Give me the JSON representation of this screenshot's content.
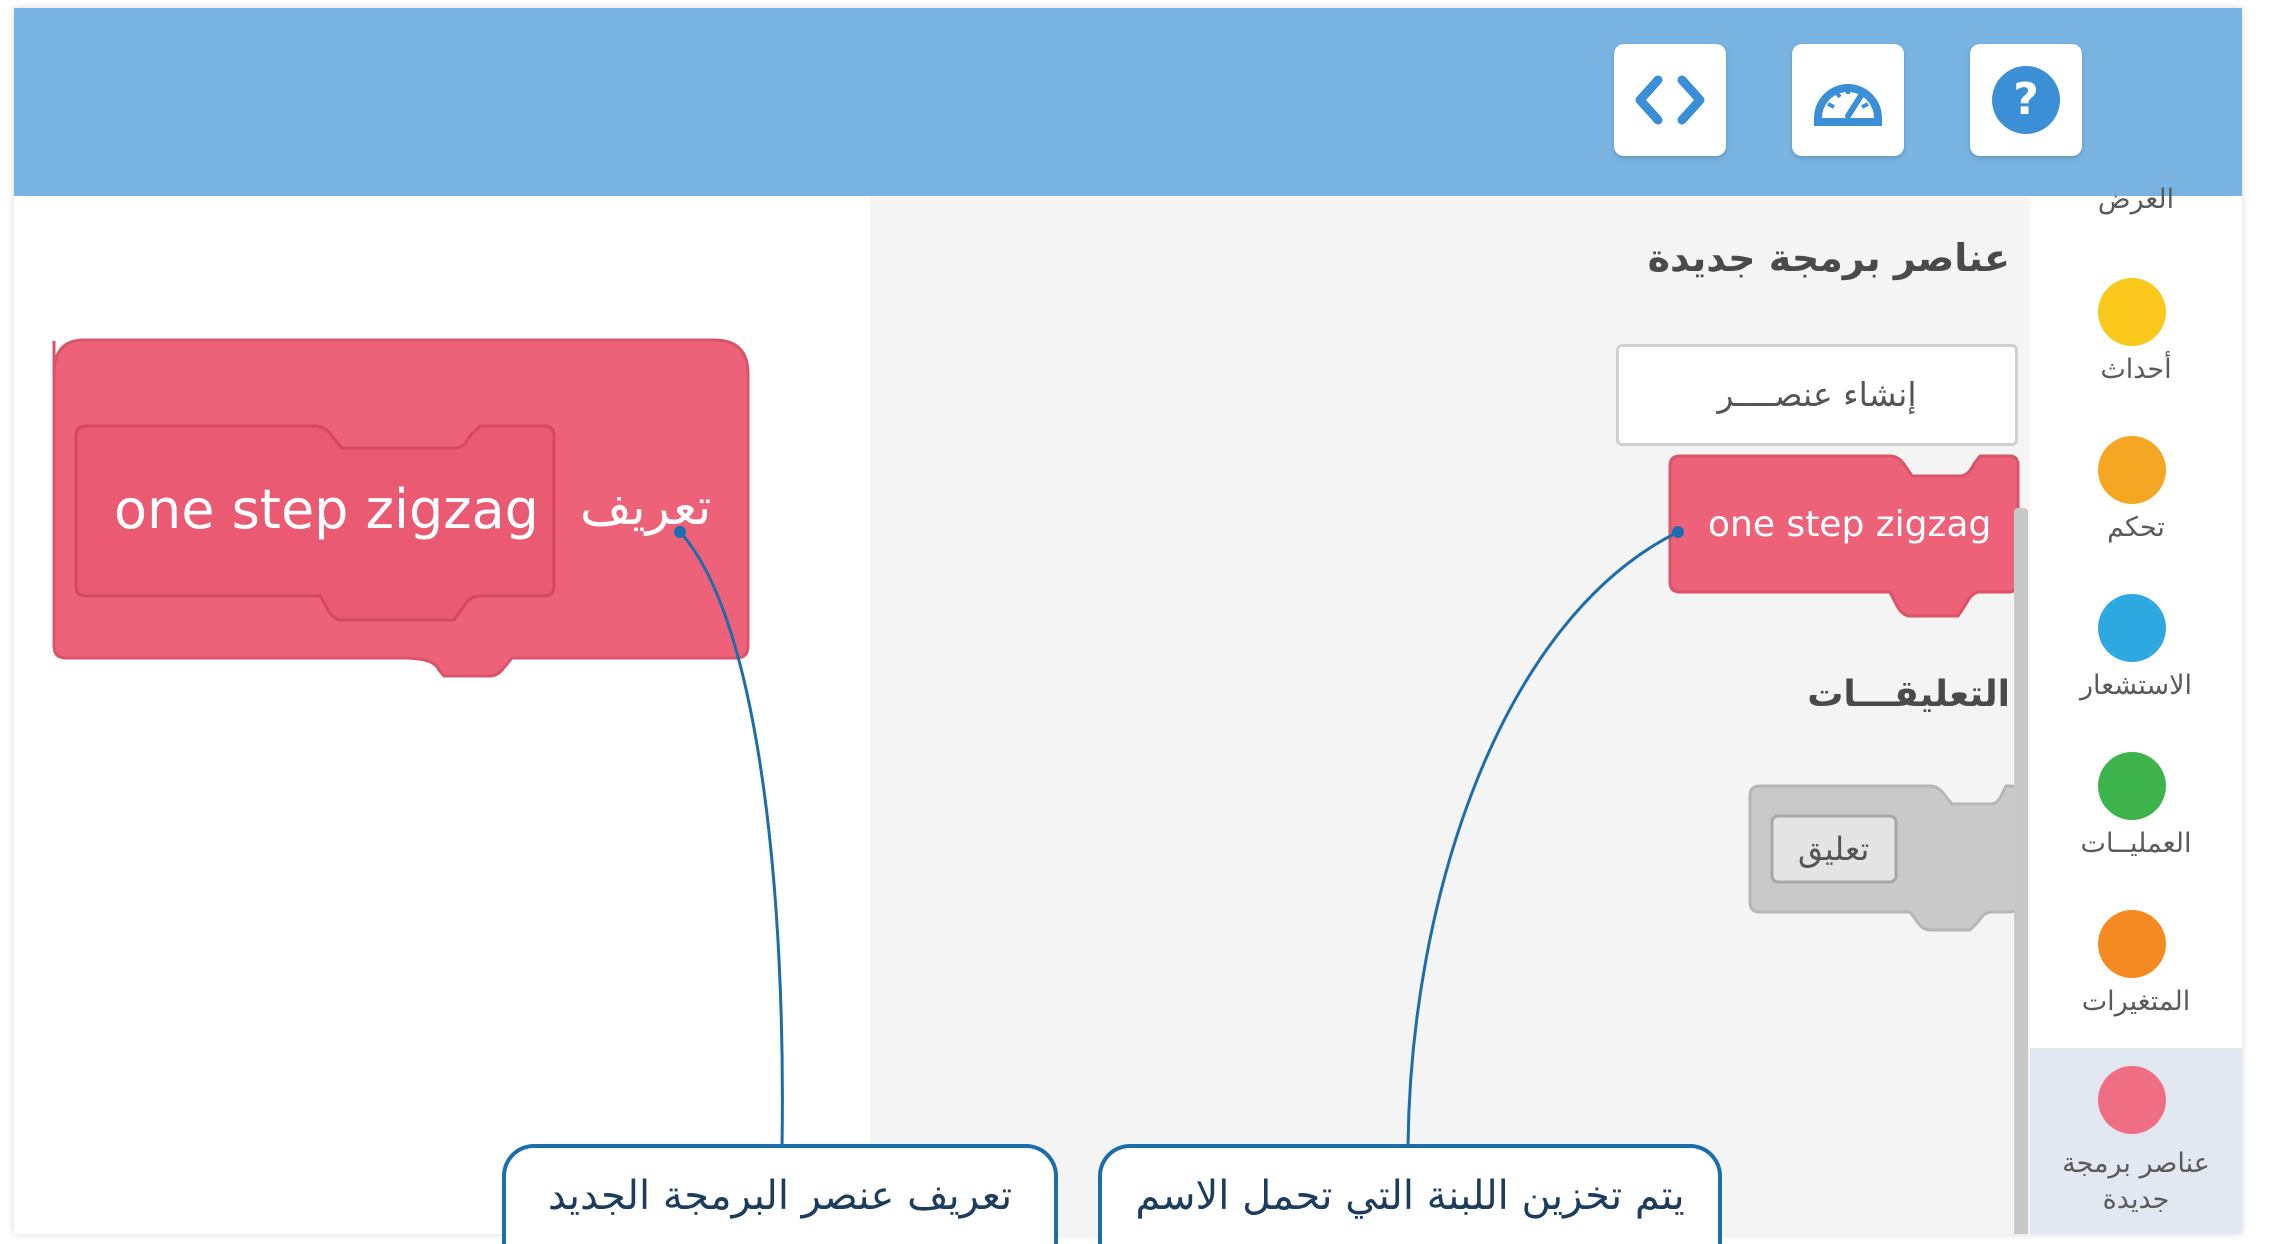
{
  "toolbar": {
    "buttons": [
      {
        "name": "code",
        "icon": "code-brackets-icon"
      },
      {
        "name": "dashboard",
        "icon": "speedometer-icon"
      },
      {
        "name": "help",
        "icon": "question-icon"
      }
    ]
  },
  "categories": {
    "partial_label": "العرض",
    "items": [
      {
        "label": "أحداث",
        "color": "#f9c81b"
      },
      {
        "label": "تحكم",
        "color": "#f5a623"
      },
      {
        "label": "الاستشعار",
        "color": "#2ea8e1"
      },
      {
        "label": "العمليــات",
        "color": "#3cb44b"
      },
      {
        "label": "المتغيرات",
        "color": "#f58a23"
      },
      {
        "label": "عناصر برمجة جديدة",
        "color": "#f06e84"
      }
    ]
  },
  "palette": {
    "section_title": "عناصر برمجة جديدة",
    "make_block_button": "إنشاء عنصــــر",
    "custom_block_label": "one step zigzag",
    "comments_title": "التعليقـــات",
    "comment_block_label": "تعليق"
  },
  "canvas": {
    "define_label": "تعريف",
    "block_name": "one step zigzag"
  },
  "callouts": {
    "left": "تعريف عنصر البرمجة الجديد",
    "right": "يتم تخزين اللبنة التي تحمل الاسم"
  },
  "colors": {
    "topbar": "#78b3e1",
    "block_pink": "#ee6279",
    "block_outline": "#d9546a",
    "comment_gray": "#c7c7c7",
    "callout_line": "#1c6dac"
  }
}
